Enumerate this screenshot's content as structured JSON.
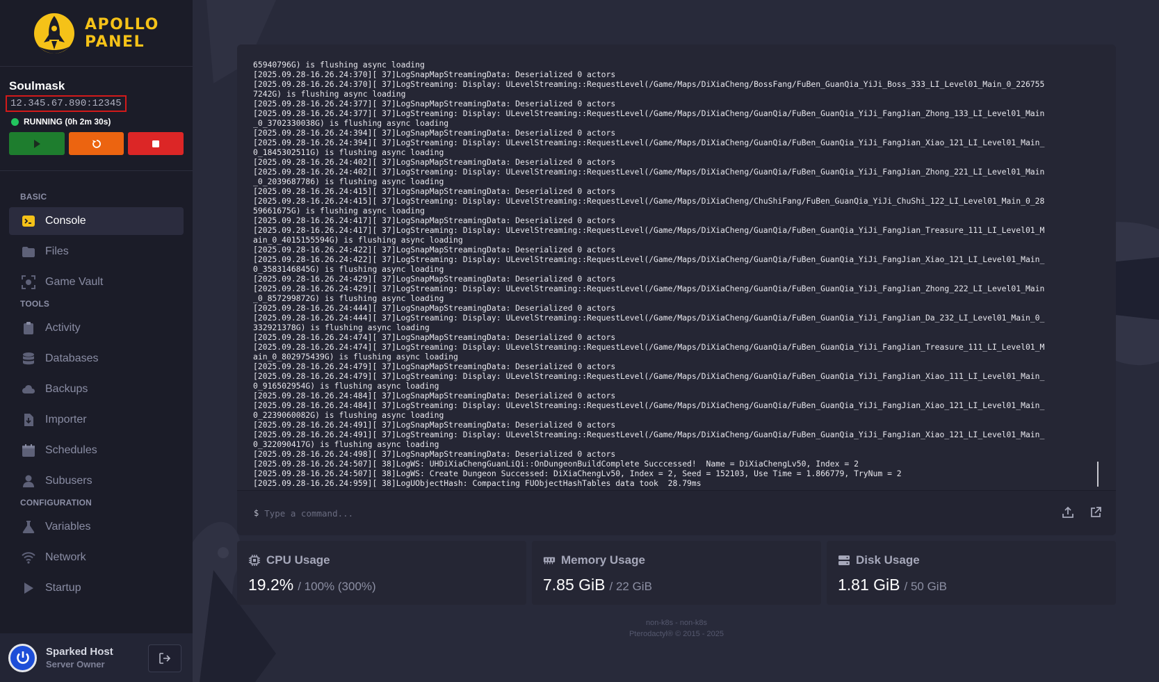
{
  "brand": {
    "line1": "APOLLO",
    "line2": "PANEL",
    "accent": "#f5c218"
  },
  "server": {
    "name": "Soulmask",
    "address": "12.345.67.890:12345",
    "status": "RUNNING (0h 2m 30s)",
    "status_color": "#22c55e"
  },
  "power": {
    "start_icon": "play-icon",
    "restart_icon": "restart-icon",
    "stop_icon": "stop-icon"
  },
  "nav": {
    "basic_label": "BASIC",
    "tools_label": "TOOLS",
    "config_label": "CONFIGURATION",
    "items": [
      {
        "label": "Console",
        "icon": "terminal-icon"
      },
      {
        "label": "Files",
        "icon": "folder-icon"
      },
      {
        "label": "Game Vault",
        "icon": "vault-icon"
      },
      {
        "label": "Activity",
        "icon": "clipboard-icon"
      },
      {
        "label": "Databases",
        "icon": "database-icon"
      },
      {
        "label": "Backups",
        "icon": "cloud-icon"
      },
      {
        "label": "Importer",
        "icon": "file-import-icon"
      },
      {
        "label": "Schedules",
        "icon": "calendar-icon"
      },
      {
        "label": "Subusers",
        "icon": "user-icon"
      },
      {
        "label": "Variables",
        "icon": "flask-icon"
      },
      {
        "label": "Network",
        "icon": "wifi-icon"
      },
      {
        "label": "Startup",
        "icon": "play-icon"
      }
    ]
  },
  "user": {
    "name": "Sparked Host",
    "role": "Server Owner"
  },
  "console": {
    "prompt": "$",
    "placeholder": "Type a command...",
    "lines": [
      "65940796G) is flushing async loading",
      "[2025.09.28-16.26.24:370][ 37]LogSnapMapStreamingData: Deserialized 0 actors",
      "[2025.09.28-16.26.24:370][ 37]LogStreaming: Display: ULevelStreaming::RequestLevel(/Game/Maps/DiXiaCheng/BossFang/FuBen_GuanQia_YiJi_Boss_333_LI_Level01_Main_0_226755",
      "7242G) is flushing async loading",
      "[2025.09.28-16.26.24:377][ 37]LogSnapMapStreamingData: Deserialized 0 actors",
      "[2025.09.28-16.26.24:377][ 37]LogStreaming: Display: ULevelStreaming::RequestLevel(/Game/Maps/DiXiaCheng/GuanQia/FuBen_GuanQia_YiJi_FangJian_Zhong_133_LI_Level01_Main",
      "_0_3702330038G) is flushing async loading",
      "[2025.09.28-16.26.24:394][ 37]LogSnapMapStreamingData: Deserialized 0 actors",
      "[2025.09.28-16.26.24:394][ 37]LogStreaming: Display: ULevelStreaming::RequestLevel(/Game/Maps/DiXiaCheng/GuanQia/FuBen_GuanQia_YiJi_FangJian_Xiao_121_LI_Level01_Main_",
      "0_1845302511G) is flushing async loading",
      "[2025.09.28-16.26.24:402][ 37]LogSnapMapStreamingData: Deserialized 0 actors",
      "[2025.09.28-16.26.24:402][ 37]LogStreaming: Display: ULevelStreaming::RequestLevel(/Game/Maps/DiXiaCheng/GuanQia/FuBen_GuanQia_YiJi_FangJian_Zhong_221_LI_Level01_Main",
      "_0_2039687786) is flushing async loading",
      "[2025.09.28-16.26.24:415][ 37]LogSnapMapStreamingData: Deserialized 0 actors",
      "[2025.09.28-16.26.24:415][ 37]LogStreaming: Display: ULevelStreaming::RequestLevel(/Game/Maps/DiXiaCheng/ChuShiFang/FuBen_GuanQia_YiJi_ChuShi_122_LI_Level01_Main_0_28",
      "59661675G) is flushing async loading",
      "[2025.09.28-16.26.24:417][ 37]LogSnapMapStreamingData: Deserialized 0 actors",
      "[2025.09.28-16.26.24:417][ 37]LogStreaming: Display: ULevelStreaming::RequestLevel(/Game/Maps/DiXiaCheng/GuanQia/FuBen_GuanQia_YiJi_FangJian_Treasure_111_LI_Level01_M",
      "ain_0_4015155594G) is flushing async loading",
      "[2025.09.28-16.26.24:422][ 37]LogSnapMapStreamingData: Deserialized 0 actors",
      "[2025.09.28-16.26.24:422][ 37]LogStreaming: Display: ULevelStreaming::RequestLevel(/Game/Maps/DiXiaCheng/GuanQia/FuBen_GuanQia_YiJi_FangJian_Xiao_121_LI_Level01_Main_",
      "0_3583146845G) is flushing async loading",
      "[2025.09.28-16.26.24:429][ 37]LogSnapMapStreamingData: Deserialized 0 actors",
      "[2025.09.28-16.26.24:429][ 37]LogStreaming: Display: ULevelStreaming::RequestLevel(/Game/Maps/DiXiaCheng/GuanQia/FuBen_GuanQia_YiJi_FangJian_Zhong_222_LI_Level01_Main",
      "_0_857299872G) is flushing async loading",
      "[2025.09.28-16.26.24:444][ 37]LogSnapMapStreamingData: Deserialized 0 actors",
      "[2025.09.28-16.26.24:444][ 37]LogStreaming: Display: ULevelStreaming::RequestLevel(/Game/Maps/DiXiaCheng/GuanQia/FuBen_GuanQia_YiJi_FangJian_Da_232_LI_Level01_Main_0_",
      "332921378G) is flushing async loading",
      "[2025.09.28-16.26.24:474][ 37]LogSnapMapStreamingData: Deserialized 0 actors",
      "[2025.09.28-16.26.24:474][ 37]LogStreaming: Display: ULevelStreaming::RequestLevel(/Game/Maps/DiXiaCheng/GuanQia/FuBen_GuanQia_YiJi_FangJian_Treasure_111_LI_Level01_M",
      "ain_0_802975439G) is flushing async loading",
      "[2025.09.28-16.26.24:479][ 37]LogSnapMapStreamingData: Deserialized 0 actors",
      "[2025.09.28-16.26.24:479][ 37]LogStreaming: Display: ULevelStreaming::RequestLevel(/Game/Maps/DiXiaCheng/GuanQia/FuBen_GuanQia_YiJi_FangJian_Xiao_111_LI_Level01_Main_",
      "0_916502954G) is flushing async loading",
      "[2025.09.28-16.26.24:484][ 37]LogSnapMapStreamingData: Deserialized 0 actors",
      "[2025.09.28-16.26.24:484][ 37]LogStreaming: Display: ULevelStreaming::RequestLevel(/Game/Maps/DiXiaCheng/GuanQia/FuBen_GuanQia_YiJi_FangJian_Xiao_121_LI_Level01_Main_",
      "0_2239060082G) is flushing async loading",
      "[2025.09.28-16.26.24:491][ 37]LogSnapMapStreamingData: Deserialized 0 actors",
      "[2025.09.28-16.26.24:491][ 37]LogStreaming: Display: ULevelStreaming::RequestLevel(/Game/Maps/DiXiaCheng/GuanQia/FuBen_GuanQia_YiJi_FangJian_Xiao_121_LI_Level01_Main_",
      "0_322090417G) is flushing async loading",
      "[2025.09.28-16.26.24:498][ 37]LogSnapMapStreamingData: Deserialized 0 actors",
      "[2025.09.28-16.26.24:507][ 38]LogWS: UHDiXiaChengGuanLiQi::OnDungeonBuildComplete Succcessed!  Name = DiXiaChengLv50, Index = 2",
      "[2025.09.28-16.26.24:507][ 38]LogWS: Create Dungeon Successed: DiXiaChengLv50, Index = 2, Seed = 152103, Use Time = 1.866779, TryNum = 2",
      "[2025.09.28-16.26.24:959][ 38]LogUObjectHash: Compacting FUObjectHashTables data took  28.79ms"
    ]
  },
  "stats": {
    "cpu": {
      "title": "CPU Usage",
      "value": "19.2%",
      "max": "/ 100% (300%)"
    },
    "memory": {
      "title": "Memory Usage",
      "value": "7.85 GiB",
      "max": "/ 22 GiB"
    },
    "disk": {
      "title": "Disk Usage",
      "value": "1.81 GiB",
      "max": "/ 50 GiB"
    }
  },
  "footer": {
    "line1": "non-k8s - non-k8s",
    "line2": "Pterodactyl® © 2015 - 2025"
  }
}
